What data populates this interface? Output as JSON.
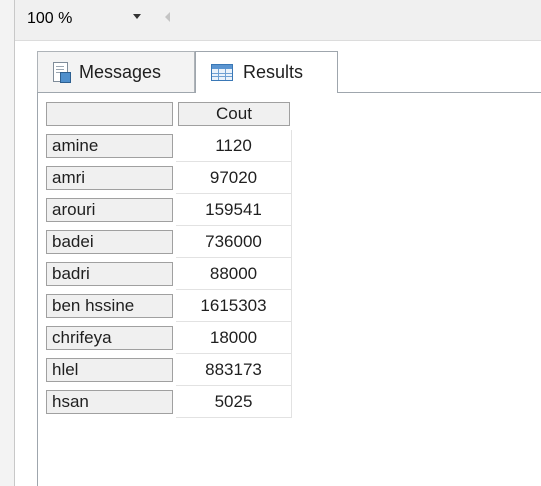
{
  "toolbar": {
    "zoom_value": "100 %"
  },
  "tabs": {
    "messages_label": "Messages",
    "results_label": "Results"
  },
  "results": {
    "column_header": "Cout",
    "rows": [
      {
        "name": "amine",
        "cout": "1120"
      },
      {
        "name": "amri",
        "cout": "97020"
      },
      {
        "name": "arouri",
        "cout": "159541"
      },
      {
        "name": "badei",
        "cout": "736000"
      },
      {
        "name": "badri",
        "cout": "88000"
      },
      {
        "name": "ben hssine",
        "cout": "1615303"
      },
      {
        "name": "chrifeya",
        "cout": "18000"
      },
      {
        "name": "hlel",
        "cout": "883173"
      },
      {
        "name": "hsan",
        "cout": "5025"
      }
    ]
  },
  "icons": {
    "messages": "messages-icon",
    "results": "results-grid-icon"
  }
}
